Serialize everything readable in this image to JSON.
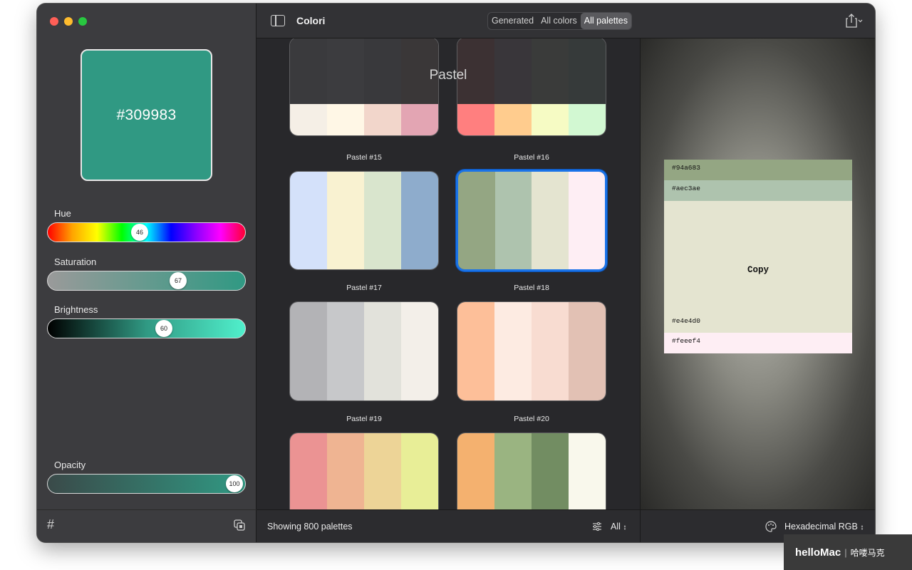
{
  "sidebar": {
    "swatch_hex": "#309983",
    "swatch_color": "#309983",
    "hue": {
      "label": "Hue",
      "value": "46",
      "level": 0.46
    },
    "saturation": {
      "label": "Saturation",
      "value": "67",
      "level": 0.67
    },
    "brightness": {
      "label": "Brightness",
      "value": "60",
      "level": 0.6
    },
    "opacity": {
      "label": "Opacity",
      "value": "100",
      "level": 1.0
    },
    "footer": {
      "hash_icon": "#"
    }
  },
  "toolbar": {
    "title": "Colori",
    "tabs": [
      {
        "label": "Generated"
      },
      {
        "label": "All colors"
      },
      {
        "label": "All palettes",
        "active": true
      }
    ]
  },
  "grid": {
    "overlay_title": "Pastel",
    "palettes": [
      {
        "name": "",
        "colors": [
          "#3a3a3d",
          "#3c3c3f",
          "#39393c",
          "#3a3738"
        ],
        "bottom": [
          "#f5efe6",
          "#fff7e6",
          "#f2d6cb",
          "#e3a5b3"
        ]
      },
      {
        "name": "",
        "colors": [
          "#3c3133",
          "#39363a",
          "#3a3b3a",
          "#363a3a"
        ],
        "bottom": [
          "#ff7f7f",
          "#ffcc8e",
          "#f6fbc4",
          "#d2f8d2"
        ]
      },
      {
        "name": "Pastel #15"
      },
      {
        "name": "Pastel #16"
      },
      {
        "name": "Pastel #17",
        "colors": [
          "#d4e1fa",
          "#f9f2d1",
          "#d9e5cd",
          "#8eaccc"
        ]
      },
      {
        "name": "Pastel #18",
        "colors": [
          "#94a683",
          "#aec3ae",
          "#e4e4d0",
          "#feeef4"
        ],
        "selected": true
      },
      {
        "name": "Pastel #19",
        "colors": [
          "#b3b3b6",
          "#c7c8ca",
          "#e2e2db",
          "#f3efe9"
        ]
      },
      {
        "name": "Pastel #20",
        "colors": [
          "#fdbf99",
          "#fdebe2",
          "#f8dcd1",
          "#e2c1b4"
        ]
      },
      {
        "name": "",
        "colors": [
          "#eb9393",
          "#efb492",
          "#edd497",
          "#e8ee97"
        ]
      },
      {
        "name": "",
        "colors": [
          "#f4b16f",
          "#9ab481",
          "#728d62",
          "#f9f8ec"
        ]
      }
    ],
    "footer": {
      "count": "Showing 800 palettes",
      "filter": "All"
    }
  },
  "preview": {
    "rows": [
      {
        "hex": "#94a683",
        "color": "#94a683"
      },
      {
        "hex": "#aec3ae",
        "color": "#aec3ae"
      },
      {
        "hex": "#e4e4d0",
        "color": "#e4e4d0"
      },
      {
        "hex": "#feeef4",
        "color": "#feeef4"
      }
    ],
    "copy_label": "Copy",
    "footer": {
      "format": "Hexadecimal RGB"
    }
  },
  "watermark": {
    "logo": "helloMac",
    "sep": "|",
    "cn": "哈喽马克"
  },
  "colors": {
    "traffic_red": "#ff5f57",
    "traffic_yellow": "#febc2e",
    "traffic_green": "#28c840",
    "selection": "#1a73e8"
  },
  "icons": [
    "sidebar-toggle-icon",
    "share-icon",
    "hash-icon",
    "copy-icon",
    "filter-icon",
    "palette-icon",
    "chevron-updown-icon"
  ]
}
